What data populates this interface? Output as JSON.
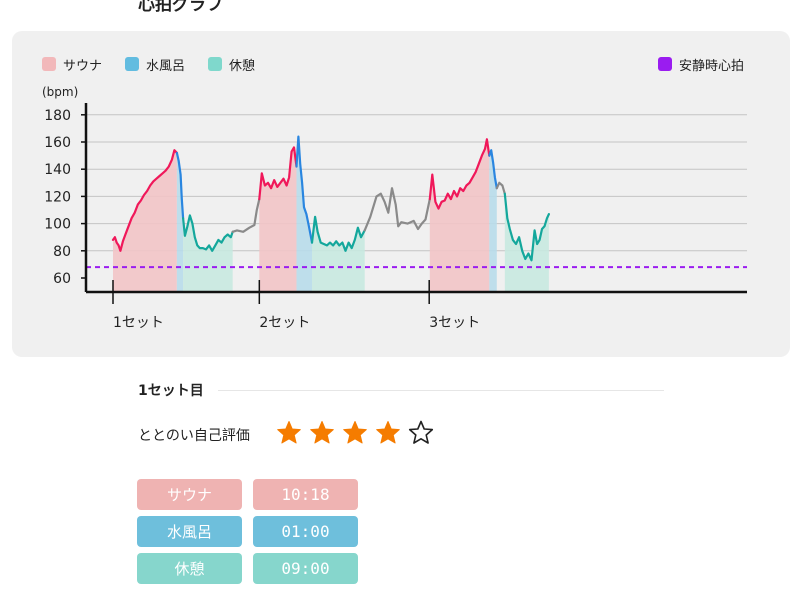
{
  "page_title": "心拍グラフ",
  "legend": {
    "sauna": "サウナ",
    "mizuburo": "水風呂",
    "kyukei": "休憩",
    "resting": "安静時心拍"
  },
  "colors": {
    "sauna_line": "#f0185a",
    "sauna_fill": "#f2c4c6",
    "mizuburo_line": "#2a86e0",
    "mizuburo_fill": "#b8dbea",
    "kyukei_line": "#14a79c",
    "kyukei_fill": "#c8e9e0",
    "transition_line": "#8a8a8a",
    "resting_line": "#9a1cf0",
    "star": "#f57c00"
  },
  "chart_data": {
    "type": "line",
    "ylabel": "(bpm)",
    "ylim": [
      50,
      190
    ],
    "yticks": [
      60,
      80,
      100,
      120,
      140,
      160,
      180
    ],
    "set_labels": [
      {
        "label": "1セット",
        "x": 0
      },
      {
        "label": "2セット",
        "x": 23.6
      },
      {
        "label": "3セット",
        "x": 51
      }
    ],
    "resting_hr": 68,
    "phases": [
      {
        "type": "sauna",
        "start": 0,
        "end": 10.3
      },
      {
        "type": "mizuburo",
        "start": 10.3,
        "end": 11.3
      },
      {
        "type": "kyukei",
        "start": 11.3,
        "end": 19.3
      },
      {
        "type": "sauna",
        "start": 23.6,
        "end": 29.6
      },
      {
        "type": "mizuburo",
        "start": 29.6,
        "end": 32.1
      },
      {
        "type": "kyukei",
        "start": 32.1,
        "end": 40.6
      },
      {
        "type": "sauna",
        "start": 51.1,
        "end": 60.7
      },
      {
        "type": "mizuburo",
        "start": 60.7,
        "end": 61.9
      },
      {
        "type": "kyukei",
        "start": 61.9,
        "end": 70.3
      }
    ],
    "series": [
      {
        "phase": "sauna",
        "points": [
          [
            0,
            88
          ],
          [
            0.3,
            90
          ],
          [
            0.6,
            86
          ],
          [
            0.9,
            84
          ],
          [
            1.2,
            80
          ],
          [
            1.6,
            87
          ],
          [
            2.0,
            92
          ],
          [
            2.5,
            98
          ],
          [
            3.0,
            104
          ],
          [
            3.5,
            108
          ],
          [
            4.0,
            114
          ],
          [
            4.5,
            117
          ],
          [
            5.0,
            121
          ],
          [
            5.5,
            124
          ],
          [
            6.0,
            128
          ],
          [
            6.5,
            131
          ],
          [
            7.0,
            133
          ],
          [
            7.5,
            135
          ],
          [
            8.0,
            137
          ],
          [
            8.5,
            139
          ],
          [
            9.0,
            142
          ],
          [
            9.5,
            147
          ],
          [
            9.9,
            154
          ],
          [
            10.3,
            152
          ]
        ]
      },
      {
        "phase": "mizuburo",
        "points": [
          [
            10.3,
            152
          ],
          [
            10.6,
            146
          ],
          [
            10.9,
            136
          ],
          [
            11.1,
            118
          ],
          [
            11.3,
            104
          ]
        ]
      },
      {
        "phase": "kyukei",
        "points": [
          [
            11.3,
            104
          ],
          [
            11.6,
            91
          ],
          [
            12.0,
            98
          ],
          [
            12.4,
            106
          ],
          [
            12.8,
            100
          ],
          [
            13.2,
            90
          ],
          [
            13.6,
            84
          ],
          [
            14.0,
            82
          ],
          [
            14.5,
            82
          ],
          [
            15.0,
            81
          ],
          [
            15.5,
            84
          ],
          [
            16.0,
            80
          ],
          [
            16.5,
            84
          ],
          [
            17.0,
            88
          ],
          [
            17.5,
            86
          ],
          [
            18.0,
            90
          ],
          [
            18.5,
            92
          ],
          [
            19.0,
            90
          ],
          [
            19.3,
            94
          ]
        ]
      },
      {
        "phase": "transition",
        "points": [
          [
            19.3,
            94
          ],
          [
            20.0,
            95
          ],
          [
            21.0,
            94
          ],
          [
            22.0,
            97
          ],
          [
            22.8,
            99
          ],
          [
            23.2,
            110
          ],
          [
            23.6,
            118
          ]
        ]
      },
      {
        "phase": "sauna",
        "points": [
          [
            23.6,
            118
          ],
          [
            24.0,
            137
          ],
          [
            24.5,
            128
          ],
          [
            25.0,
            130
          ],
          [
            25.5,
            126
          ],
          [
            26.0,
            132
          ],
          [
            26.5,
            127
          ],
          [
            27.0,
            130
          ],
          [
            27.5,
            133
          ],
          [
            28.0,
            128
          ],
          [
            28.4,
            134
          ],
          [
            28.8,
            153
          ],
          [
            29.2,
            156
          ],
          [
            29.6,
            142
          ]
        ]
      },
      {
        "phase": "mizuburo",
        "points": [
          [
            29.6,
            142
          ],
          [
            29.9,
            164
          ],
          [
            30.2,
            144
          ],
          [
            30.5,
            130
          ],
          [
            30.8,
            112
          ],
          [
            31.2,
            107
          ],
          [
            31.6,
            98
          ],
          [
            32.1,
            86
          ]
        ]
      },
      {
        "phase": "kyukei",
        "points": [
          [
            32.1,
            86
          ],
          [
            32.6,
            105
          ],
          [
            33.0,
            94
          ],
          [
            33.5,
            86
          ],
          [
            34.0,
            85
          ],
          [
            34.5,
            84
          ],
          [
            35.0,
            86
          ],
          [
            35.5,
            84
          ],
          [
            36.0,
            87
          ],
          [
            36.5,
            84
          ],
          [
            37.0,
            86
          ],
          [
            37.5,
            80
          ],
          [
            38.0,
            86
          ],
          [
            38.5,
            82
          ],
          [
            39.0,
            88
          ],
          [
            39.5,
            97
          ],
          [
            40.0,
            90
          ],
          [
            40.6,
            95
          ]
        ]
      },
      {
        "phase": "transition",
        "points": [
          [
            40.6,
            95
          ],
          [
            41.5,
            105
          ],
          [
            42.5,
            120
          ],
          [
            43.2,
            122
          ],
          [
            43.8,
            116
          ],
          [
            44.4,
            108
          ],
          [
            45.0,
            126
          ],
          [
            45.6,
            114
          ],
          [
            46.0,
            98
          ],
          [
            46.5,
            101
          ],
          [
            47.5,
            100
          ],
          [
            48.5,
            102
          ],
          [
            49.2,
            96
          ],
          [
            49.8,
            100
          ],
          [
            50.4,
            103
          ],
          [
            51.1,
            118
          ]
        ]
      },
      {
        "phase": "sauna",
        "points": [
          [
            51.1,
            118
          ],
          [
            51.5,
            136
          ],
          [
            52.0,
            116
          ],
          [
            52.5,
            111
          ],
          [
            53.0,
            116
          ],
          [
            53.5,
            117
          ],
          [
            54.0,
            122
          ],
          [
            54.5,
            118
          ],
          [
            55.0,
            124
          ],
          [
            55.5,
            120
          ],
          [
            56.0,
            126
          ],
          [
            56.5,
            124
          ],
          [
            57.0,
            128
          ],
          [
            57.5,
            130
          ],
          [
            58.0,
            134
          ],
          [
            58.5,
            138
          ],
          [
            59.0,
            144
          ],
          [
            59.5,
            150
          ],
          [
            60.0,
            155
          ],
          [
            60.3,
            162
          ],
          [
            60.7,
            150
          ]
        ]
      },
      {
        "phase": "mizuburo",
        "points": [
          [
            60.7,
            150
          ],
          [
            61.0,
            154
          ],
          [
            61.3,
            145
          ],
          [
            61.6,
            134
          ],
          [
            61.9,
            126
          ]
        ]
      },
      {
        "phase": "transition",
        "points": [
          [
            61.9,
            126
          ],
          [
            62.3,
            130
          ],
          [
            62.8,
            128
          ],
          [
            63.2,
            122
          ]
        ]
      },
      {
        "phase": "kyukei",
        "points": [
          [
            63.2,
            122
          ],
          [
            63.6,
            104
          ],
          [
            64.0,
            96
          ],
          [
            64.5,
            88
          ],
          [
            65.0,
            85
          ],
          [
            65.5,
            90
          ],
          [
            66.0,
            80
          ],
          [
            66.5,
            74
          ],
          [
            67.0,
            78
          ],
          [
            67.5,
            73
          ],
          [
            68.0,
            95
          ],
          [
            68.4,
            85
          ],
          [
            68.8,
            88
          ],
          [
            69.2,
            96
          ],
          [
            69.6,
            98
          ],
          [
            70.0,
            104
          ],
          [
            70.3,
            107
          ]
        ]
      }
    ]
  },
  "set_detail": {
    "title": "1セット目",
    "rating_label": "ととのい自己評価",
    "rating": 4,
    "rating_max": 5,
    "rows": [
      {
        "label": "サウナ",
        "value": "10:18"
      },
      {
        "label": "水風呂",
        "value": "01:00"
      },
      {
        "label": "休憩",
        "value": "09:00"
      }
    ]
  }
}
